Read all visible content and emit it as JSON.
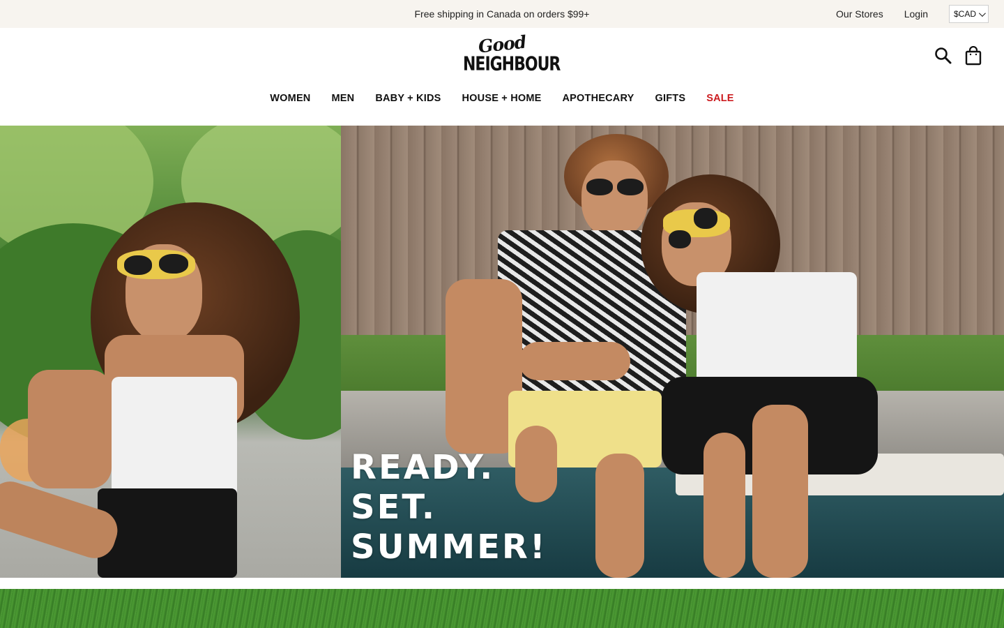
{
  "announcement": {
    "promo": "Free shipping in Canada on orders $99+",
    "links": [
      "Our Stores",
      "Login"
    ],
    "currency": "$CAD"
  },
  "header": {
    "logo_script": "Good",
    "logo_block": "NEIGHBOUR",
    "icons": [
      "search-icon",
      "shopping-bag-icon"
    ]
  },
  "nav": {
    "items": [
      "WOMEN",
      "MEN",
      "BABY + KIDS",
      "HOUSE + HOME",
      "APOTHECARY",
      "GIFTS",
      "SALE"
    ],
    "sale_color": "#cc1b1f"
  },
  "hero": {
    "headline": [
      "READY.",
      "SET.",
      "SUMMER!"
    ]
  },
  "colors": {
    "announcement_bg": "#f7f4ef",
    "text": "#111111",
    "accent_sale": "#cc1b1f"
  }
}
